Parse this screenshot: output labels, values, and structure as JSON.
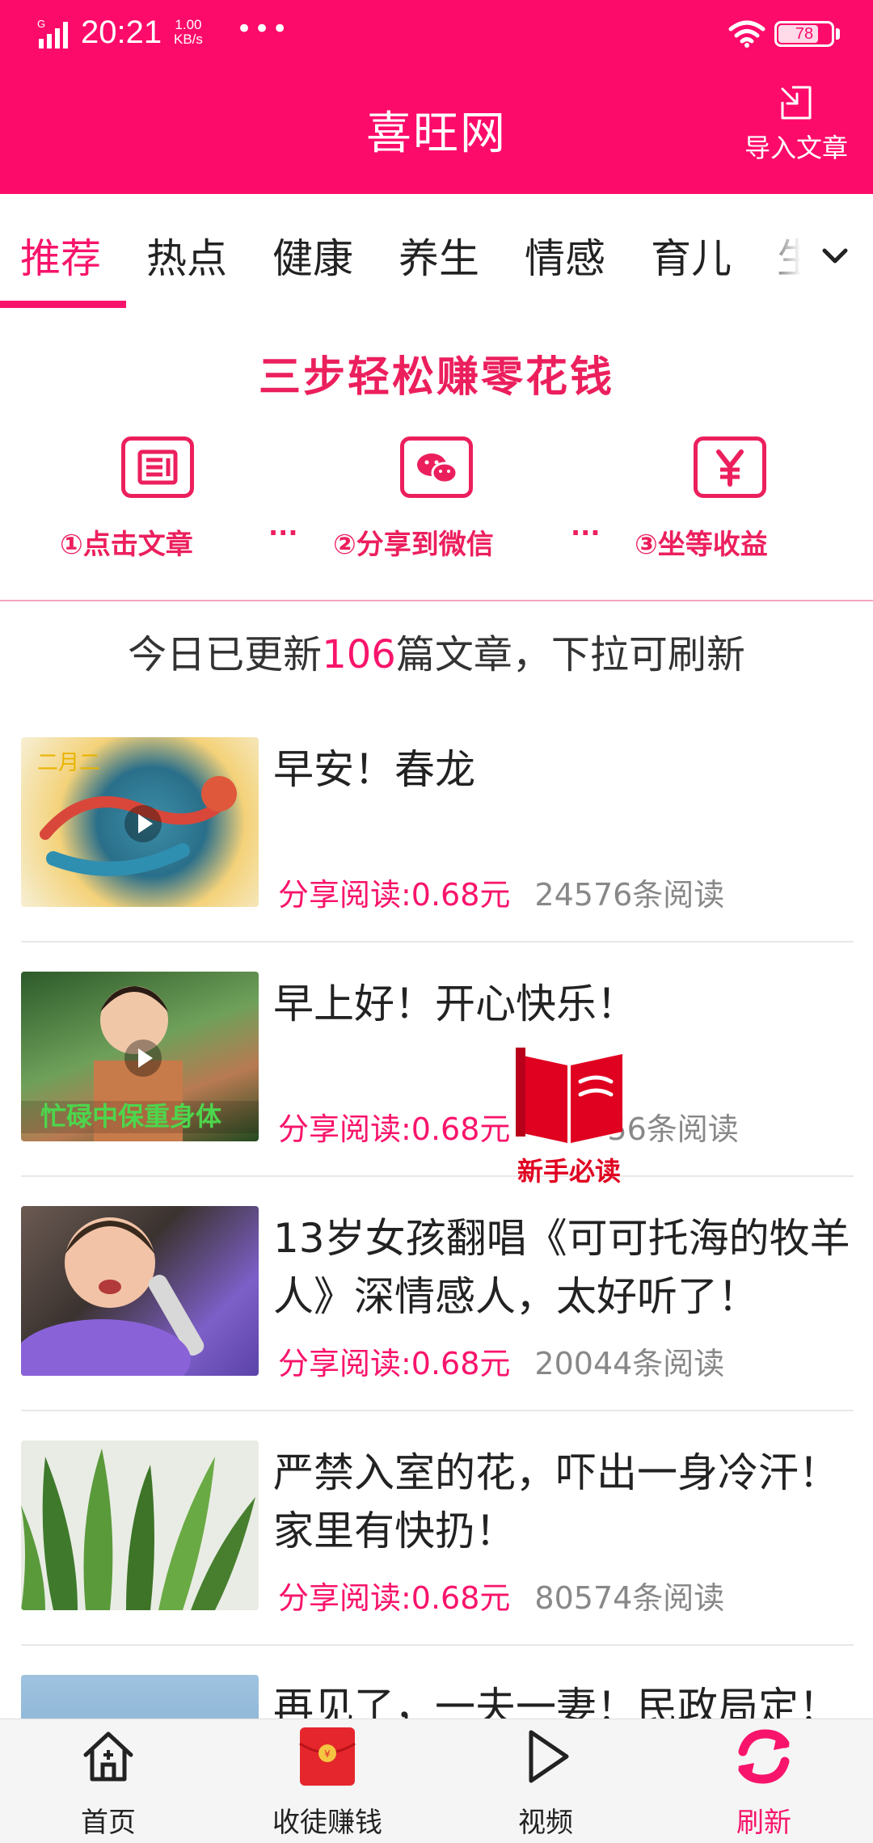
{
  "status_bar": {
    "time": "20:21",
    "speed_value": "1.00",
    "speed_unit": "KB/s",
    "more": "•••",
    "battery": "78"
  },
  "header": {
    "title": "喜旺网",
    "import_label": "导入文章",
    "bg_color": "#fd0b6a"
  },
  "tabs": {
    "items": [
      "推荐",
      "热点",
      "健康",
      "养生",
      "情感",
      "育儿",
      "生"
    ],
    "active_index": 0,
    "active_color": "#f8146b",
    "more_icon": "chevron-down-icon"
  },
  "banner": {
    "title": "三步轻松赚零花钱",
    "steps": [
      {
        "label": "①点击文章",
        "icon": "article-icon"
      },
      {
        "label": "②分享到微信",
        "icon": "wechat-icon"
      },
      {
        "label": "③坐等收益",
        "icon": "yuan-icon"
      }
    ],
    "separator": "···"
  },
  "notice": {
    "prefix": "今日已更新",
    "count": "106",
    "suffix": "篇文章，下拉可刷新"
  },
  "articles": [
    {
      "title": "早安！春龙",
      "price": "分享阅读:0.68元",
      "reads": "24576条阅读",
      "is_video": true
    },
    {
      "title": "早上好！开心快乐！",
      "price": "分享阅读:0.68元",
      "reads": "56条阅读",
      "is_video": true
    },
    {
      "title": "13岁女孩翻唱《可可托海的牧羊人》深情感人，太好听了！",
      "price": "分享阅读:0.68元",
      "reads": "20044条阅读",
      "is_video": false
    },
    {
      "title": "严禁入室的花，吓出一身冷汗！家里有快扔！",
      "price": "分享阅读:0.68元",
      "reads": "80574条阅读",
      "is_video": false
    },
    {
      "title": "再见了，一夫一妻！民政局定！"
    }
  ],
  "float_guide": {
    "label": "新手必读",
    "icon": "book-icon"
  },
  "bottom_nav": {
    "items": [
      {
        "label": "首页",
        "icon": "home-icon"
      },
      {
        "label": "收徒赚钱",
        "icon": "red-envelope-icon"
      },
      {
        "label": "视频",
        "icon": "play-icon"
      },
      {
        "label": "刷新",
        "icon": "refresh-icon"
      }
    ]
  }
}
